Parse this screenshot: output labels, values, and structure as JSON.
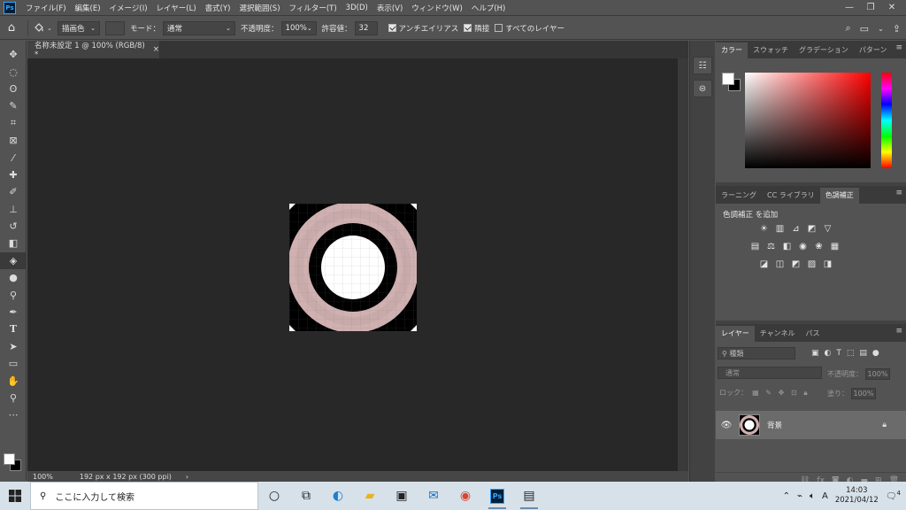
{
  "app": {
    "logo": "Ps",
    "menus": [
      "ファイル(F)",
      "編集(E)",
      "イメージ(I)",
      "レイヤー(L)",
      "書式(Y)",
      "選択範囲(S)",
      "フィルター(T)",
      "3D(D)",
      "表示(V)",
      "ウィンドウ(W)",
      "ヘルプ(H)"
    ],
    "window_controls": [
      "—",
      "❐",
      "✕"
    ]
  },
  "options": {
    "fill_source": "描画色",
    "mode_label": "モード：",
    "mode_value": "通常",
    "opacity_label": "不透明度：",
    "opacity_value": "100%",
    "tolerance_label": "許容値：",
    "tolerance_value": "32",
    "antialias_label": "アンチエイリアス",
    "antialias_checked": true,
    "contiguous_label": "隣接",
    "contiguous_checked": true,
    "all_layers_label": "すべてのレイヤー",
    "all_layers_checked": false
  },
  "tools": [
    "move-tool",
    "marquee-tool",
    "lasso-tool",
    "quick-select-tool",
    "crop-tool",
    "frame-tool",
    "eyedropper-tool",
    "healing-brush-tool",
    "brush-tool",
    "clone-stamp-tool",
    "history-brush-tool",
    "eraser-tool",
    "paint-bucket-tool",
    "blur-tool",
    "dodge-tool",
    "pen-tool",
    "type-tool",
    "path-select-tool",
    "rectangle-tool",
    "hand-tool",
    "zoom-tool",
    "more-tools"
  ],
  "active_tool": "paint-bucket-tool",
  "document": {
    "tab_title": "名称未設定 1 @ 100% (RGB/8) *",
    "zoom": "100%",
    "size_info": "192 px x 192 px (300 ppi)",
    "ring_color": "#d0b0b0",
    "checker_light": "#ffffff",
    "checker_dark": "#cccccc"
  },
  "color_panel": {
    "tabs": [
      "カラー",
      "スウォッチ",
      "グラデーション",
      "パターン"
    ],
    "fg": "#ffffff",
    "bg": "#000000"
  },
  "adj_panel": {
    "tabs": [
      "ラーニング",
      "CC ライブラリ",
      "色調補正"
    ],
    "title": "色調補正 を追加"
  },
  "layers_panel": {
    "tabs": [
      "レイヤー",
      "チャンネル",
      "パス"
    ],
    "filter_placeholder": "種類",
    "blend_mode": "通常",
    "opacity_label": "不透明度：",
    "opacity_value": "100%",
    "lock_label": "ロック：",
    "fill_label": "塗り：",
    "fill_value": "100%",
    "layer_name": "背景"
  },
  "taskbar": {
    "search_placeholder": "ここに入力して検索",
    "time": "14:03",
    "date": "2021/04/12",
    "ime": "A",
    "notifications": "4"
  }
}
